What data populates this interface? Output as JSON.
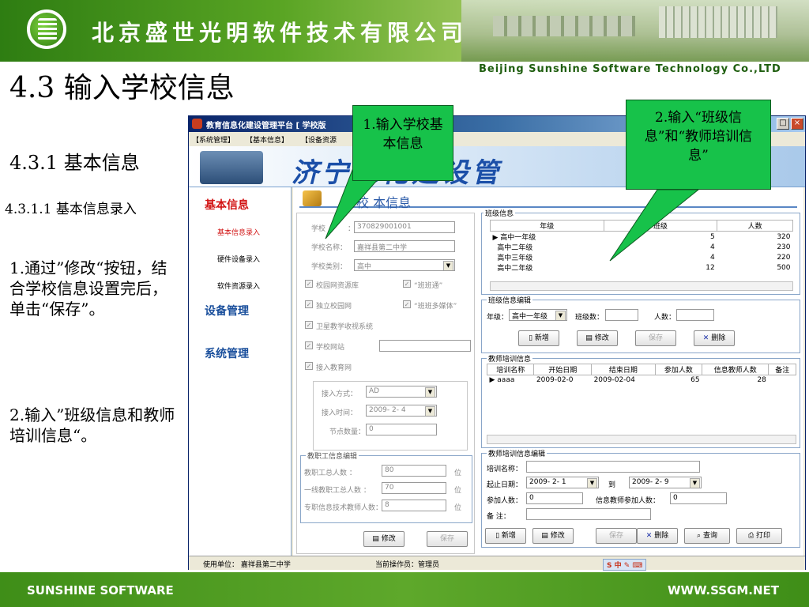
{
  "header": {
    "company_cn": "北京盛世光明软件技术有限公司",
    "company_en": "Beijing Sunshine Software Technology Co.,LTD"
  },
  "slide": {
    "title": "4.3 输入学校信息",
    "section": "4.3.1 基本信息",
    "subsection": "4.3.1.1 基本信息录入",
    "step1": "1.通过”修改“按钮，结合学校信息设置完后，单击“保存”。",
    "step2": "2.输入”班级信息和教师培训信息“。"
  },
  "window": {
    "title": "教育信息化建设管理平台 [ 学校版",
    "menu": [
      "【系统管理】",
      "【基本信息】",
      "【设备资源"
    ],
    "banner": "济宁息化建设管",
    "nav": {
      "basic_info": "基本信息",
      "items": [
        "基本信息录入",
        "硬件设备录入",
        "软件资源录入"
      ],
      "device_mgmt": "设备管理",
      "system_mgmt": "系统管理"
    },
    "page_header": "学校  本信息",
    "school": {
      "code_label": "学校",
      "code_label_tail": "：",
      "code_value": "370829001001",
      "name_label": "学校名称：",
      "name_value": "嘉祥县第二中学",
      "type_label": "学校类别：",
      "type_value": "高中",
      "checks": [
        "校园网资源库",
        "“班班通”",
        "独立校园网",
        "“班班多媒体”",
        "卫星教学收视系统",
        "学校网站",
        "接入教育网"
      ],
      "access_mode_label": "接入方式：",
      "access_mode_value": "AD",
      "access_time_label": "接入时间：",
      "access_time_value": "2009- 2- 4",
      "node_count_label": "节点数量：",
      "node_count_value": "0"
    },
    "staff": {
      "title": "教职工信息编辑",
      "total_label": "教职工总人数 ：",
      "total_value": "80",
      "frontline_label": "一线教职工总人数 ：",
      "frontline_value": "70",
      "it_label": "专职信息技术教师人数：",
      "it_value": "8",
      "unit": "位",
      "modify": "修改",
      "save": "保存"
    },
    "class_info": {
      "title": "班级信息",
      "columns": [
        "年级",
        "班级",
        "人数"
      ],
      "rows": [
        {
          "grade": "高中一年级",
          "classes": "5",
          "people": "320"
        },
        {
          "grade": "高中二年级",
          "classes": "4",
          "people": "230"
        },
        {
          "grade": "高中三年级",
          "classes": "4",
          "people": "220"
        },
        {
          "grade": "高中二年级",
          "classes": "12",
          "people": "500"
        }
      ]
    },
    "class_edit": {
      "title": "班级信息编辑",
      "grade_label": "年级：",
      "grade_value": "高中一年级",
      "class_count_label": "班级数：",
      "people_label": "人数：",
      "new": "新增",
      "modify": "修改",
      "save": "保存",
      "delete": "删除"
    },
    "training_info": {
      "title": "教师培训信息",
      "columns": [
        "培训名称",
        "开始日期",
        "结束日期",
        "参加人数",
        "信息教师人数",
        "备注"
      ],
      "rows": [
        {
          "name": "aaaa",
          "start": "2009-02-0",
          "end": "2009-02-04",
          "count": "65",
          "it": "28",
          "note": ""
        }
      ]
    },
    "training_edit": {
      "title": "教师培训信息编辑",
      "name_label": "培训名称：",
      "date_label": "起止日期：",
      "date_from": "2009- 2- 1",
      "to": "到",
      "date_to": "2009- 2- 9",
      "count_label": "参加人数：",
      "count_value": "0",
      "it_label": "信息教师参加人数：",
      "it_value": "0",
      "note_label": "备  注：",
      "new": "新增",
      "modify": "修改",
      "save": "保存",
      "delete": "删除",
      "query": "查询",
      "print": "打印"
    },
    "status": {
      "unit": "使用单位：  嘉祥县第二中学",
      "operator": "当前操作员：管理员"
    }
  },
  "callouts": {
    "c1": "1.输入学校基本信息",
    "c2": "2.输入“班级信息”和“教师培训信息”"
  },
  "footer": {
    "left": "SUNSHINE SOFTWARE",
    "right": "WWW.SSGM.NET"
  },
  "colors": {
    "header_green": "#5aa524",
    "callout_green": "#17c24a",
    "footer_green": "#4e9a22",
    "nav_red": "#d21414",
    "nav_blue": "#1a4f9c"
  }
}
